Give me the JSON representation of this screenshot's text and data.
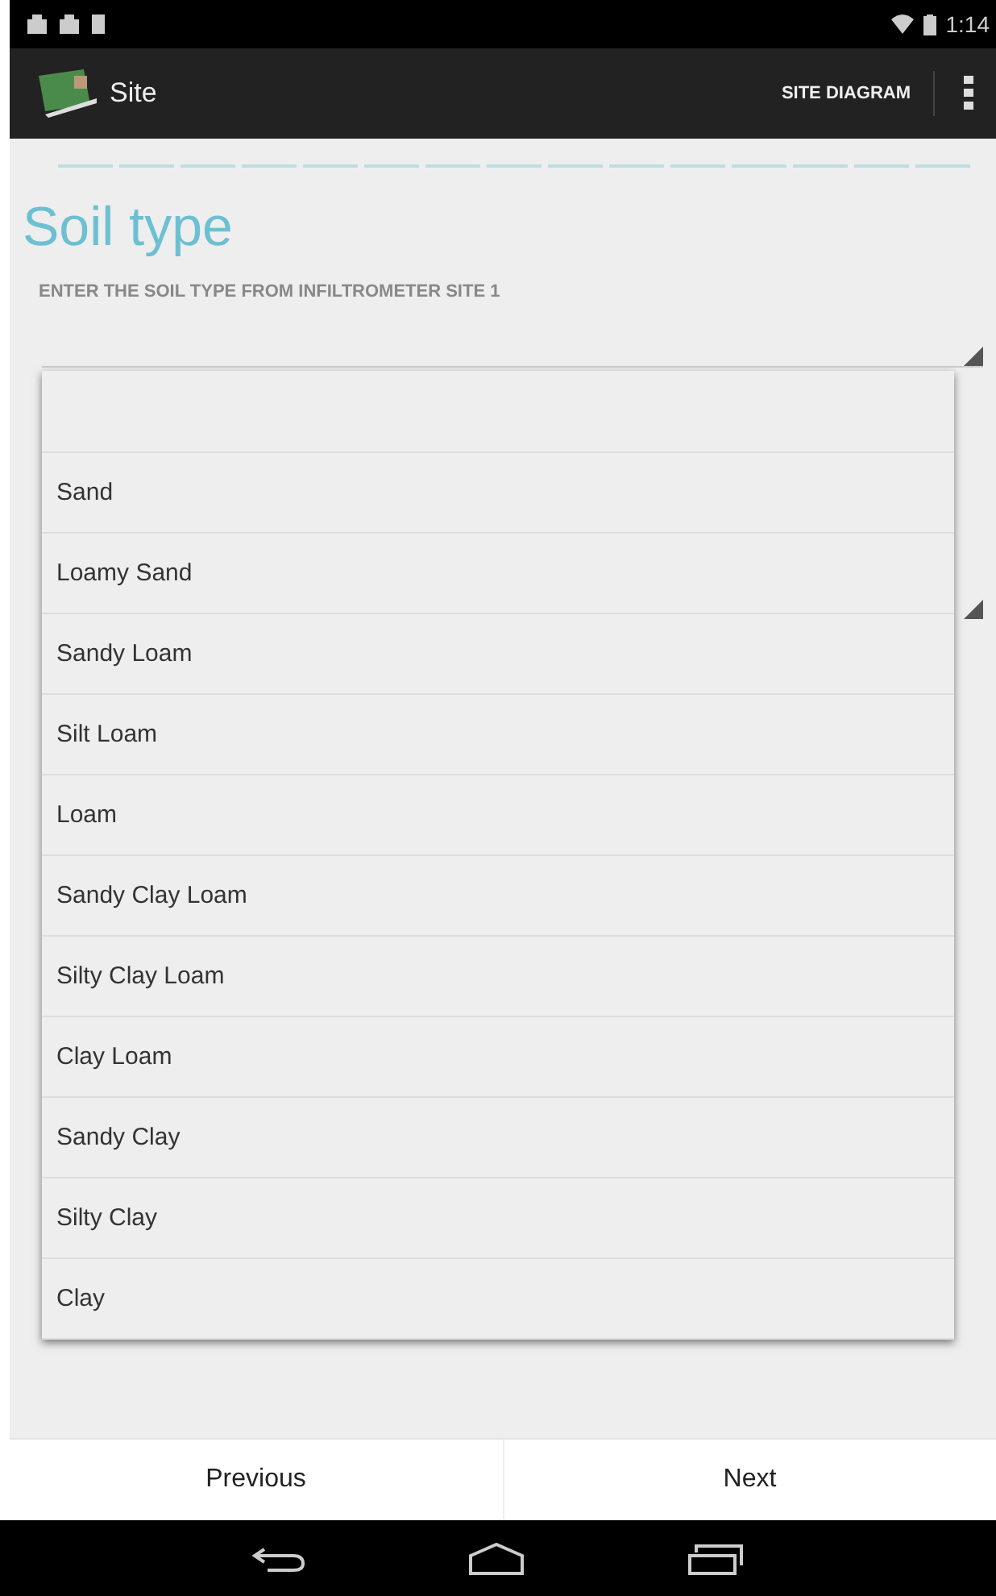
{
  "status_bar": {
    "time": "1:14"
  },
  "app_bar": {
    "title": "Site",
    "action": "SITE DIAGRAM"
  },
  "heading": "Soil type",
  "prompt": "ENTER THE SOIL TYPE FROM INFILTROMETER SITE 1",
  "dropdown": {
    "options": [
      {
        "selected": false
      },
      {
        "label": "Sand",
        "selected": false
      },
      {
        "label": "Loamy Sand",
        "selected": false
      },
      {
        "label": "Sandy Loam",
        "selected": false
      },
      {
        "label": "Silt Loam",
        "selected": false
      },
      {
        "label": "Loam",
        "selected": false
      },
      {
        "label": "Sandy Clay Loam",
        "selected": false
      },
      {
        "label": "Silty Clay Loam",
        "selected": false
      },
      {
        "label": "Clay Loam",
        "selected": false
      },
      {
        "label": "Sandy Clay",
        "selected": false
      },
      {
        "label": "Silty Clay",
        "selected": false
      },
      {
        "label": "Clay",
        "selected": false
      }
    ]
  },
  "buttons": [
    "Previous",
    "Next"
  ]
}
